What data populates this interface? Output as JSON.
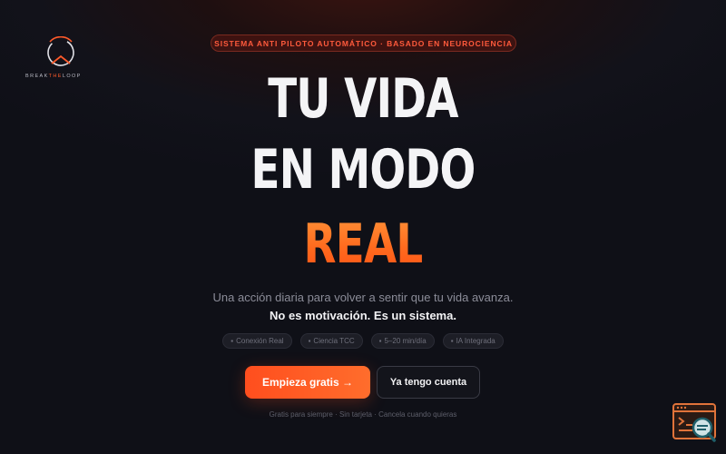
{
  "brand": {
    "logo_text_pre": "BREAK",
    "logo_text_mid": "THE",
    "logo_text_post": "LOOP",
    "accent": "#ff5a2a"
  },
  "badge": {
    "text": "SISTEMA ANTI PILOTO AUTOMÁTICO · BASADO EN NEUROCIENCIA"
  },
  "hero": {
    "line1": "TU VIDA",
    "line2": "EN MODO",
    "accent_word": "REAL",
    "subtitle": "Una acción diaria para volver a sentir que tu vida avanza.",
    "tagline": "No es motivación. Es un sistema."
  },
  "chips": [
    {
      "icon": "connection-icon",
      "label": "Conexión Real"
    },
    {
      "icon": "science-icon",
      "label": "Ciencia TCC"
    },
    {
      "icon": "timer-icon",
      "label": "5–20 min/día"
    },
    {
      "icon": "ai-icon",
      "label": "IA Integrada"
    }
  ],
  "cta": {
    "primary_label": "Empieza gratis →",
    "secondary_label": "Ya tengo cuenta"
  },
  "fineprint": "Gratis para siempre · Sin tarjeta · Cancela cuando quieras",
  "colors": {
    "primary": "#ff5a24",
    "background": "#12121a",
    "badge_text": "#ff5a3c"
  },
  "widget": {
    "icon": "terminal-search-icon"
  }
}
